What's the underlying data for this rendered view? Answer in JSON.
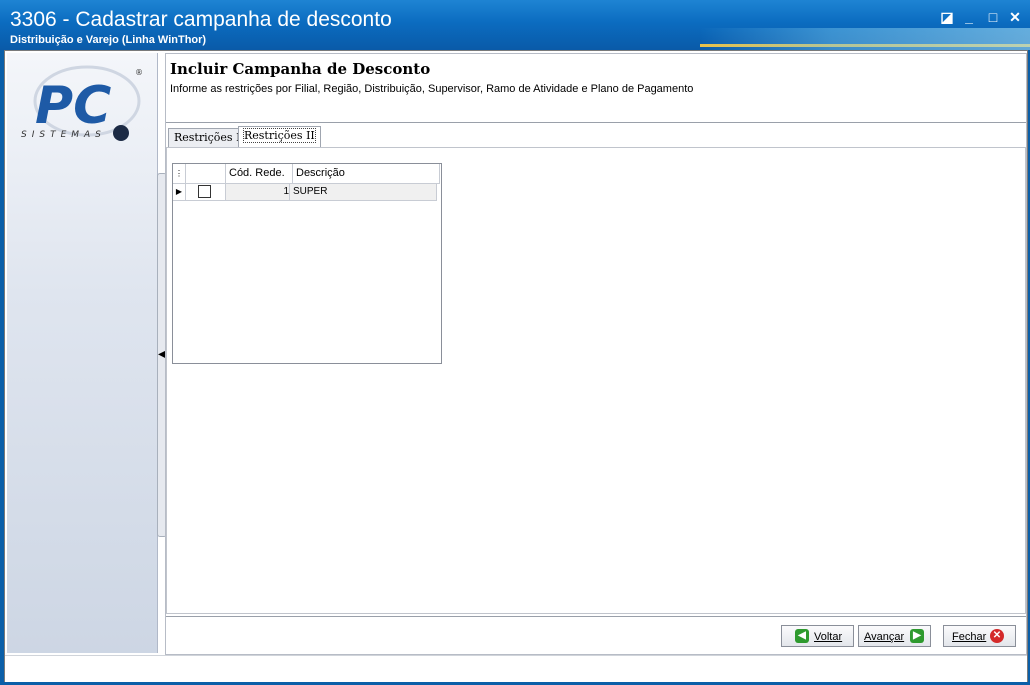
{
  "window": {
    "title": "3306 - Cadastrar campanha de desconto",
    "subtitle": "Distribuição e Varejo (Linha WinThor)",
    "controls": {
      "restore": "◪",
      "minimize": "_",
      "maximize": "□",
      "close": "✕"
    }
  },
  "logo": {
    "letters": "PC",
    "brand": "SISTEMAS",
    "registered": "®"
  },
  "header": {
    "title": "Incluir Campanha de Desconto",
    "description": "Informe as restrições por Filial, Região, Distribuição, Supervisor, Ramo de Atividade e Plano de Pagamento"
  },
  "tabs": [
    {
      "label": "Restrições I",
      "active": false
    },
    {
      "label": "Restrições II",
      "active": true
    }
  ],
  "grid": {
    "columns": [
      "Cód. Rede.",
      "Descrição"
    ],
    "rows": [
      {
        "codigo": "1",
        "descricao": "SUPER",
        "checked": false
      }
    ]
  },
  "buttons": {
    "voltar": "Voltar",
    "avancar": "Avançar",
    "fechar": "Fechar"
  },
  "colors": {
    "titlebar": "#0b6cc0",
    "accent_gold": "#e8c24a",
    "btn_green": "#2e9a2e",
    "btn_red": "#d42a2a"
  }
}
